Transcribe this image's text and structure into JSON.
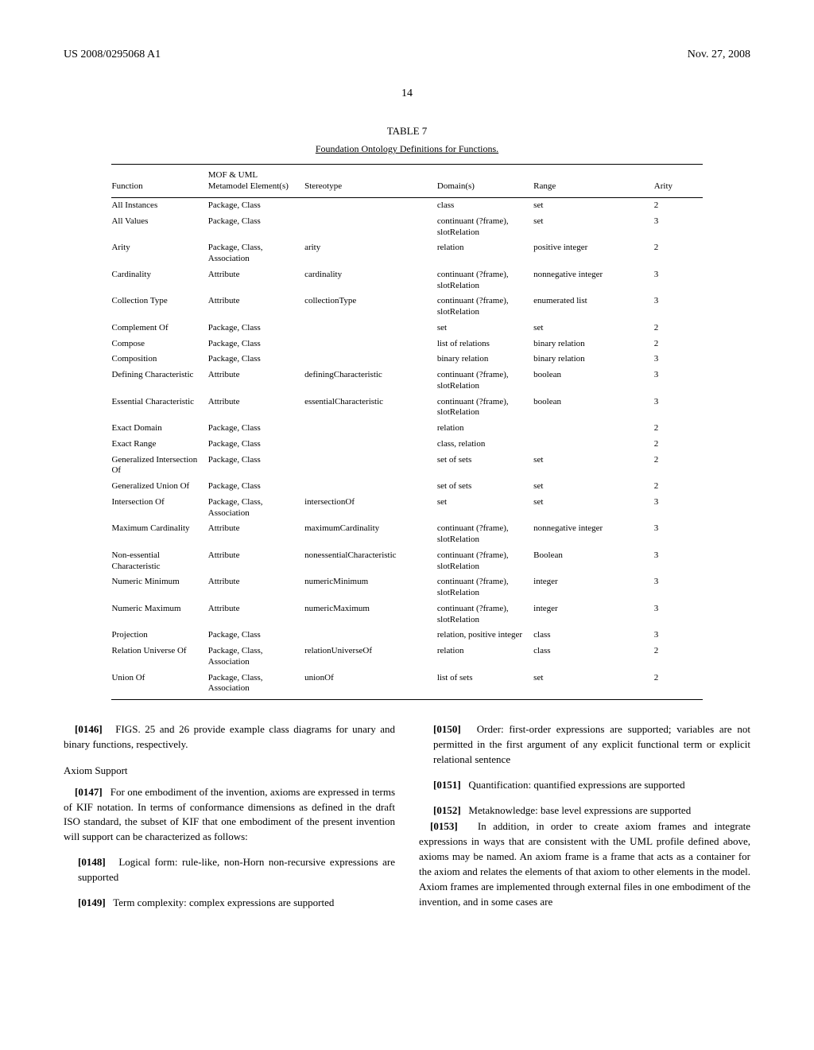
{
  "header": {
    "pub_id": "US 2008/0295068 A1",
    "pub_date": "Nov. 27, 2008",
    "page": "14"
  },
  "table": {
    "label": "TABLE 7",
    "caption": "Foundation Ontology Definitions for Functions.",
    "columns": [
      "Function",
      "MOF & UML Metamodel Element(s)",
      "Stereotype",
      "Domain(s)",
      "Range",
      "Arity"
    ],
    "rows": [
      {
        "f": "All Instances",
        "e": "Package, Class",
        "s": "",
        "d": "class",
        "r": "set",
        "a": "2"
      },
      {
        "f": "All Values",
        "e": "Package, Class",
        "s": "",
        "d": "continuant (?frame), slotRelation",
        "r": "set",
        "a": "3"
      },
      {
        "f": "Arity",
        "e": "Package, Class, Association",
        "s": "arity",
        "d": "relation",
        "r": "positive integer",
        "a": "2"
      },
      {
        "f": "Cardinality",
        "e": "Attribute",
        "s": "cardinality",
        "d": "continuant (?frame), slotRelation",
        "r": "nonnegative integer",
        "a": "3"
      },
      {
        "f": "Collection Type",
        "e": "Attribute",
        "s": "collectionType",
        "d": "continuant (?frame), slotRelation",
        "r": "enumerated list",
        "a": "3"
      },
      {
        "f": "Complement Of",
        "e": "Package, Class",
        "s": "",
        "d": "set",
        "r": "set",
        "a": "2"
      },
      {
        "f": "Compose",
        "e": "Package, Class",
        "s": "",
        "d": "list of relations",
        "r": "binary relation",
        "a": "2"
      },
      {
        "f": "Composition",
        "e": "Package, Class",
        "s": "",
        "d": "binary relation",
        "r": "binary relation",
        "a": "3"
      },
      {
        "f": "Defining Characteristic",
        "e": "Attribute",
        "s": "definingCharacteristic",
        "d": "continuant (?frame), slotRelation",
        "r": "boolean",
        "a": "3"
      },
      {
        "f": "Essential Characteristic",
        "e": "Attribute",
        "s": "essentialCharacteristic",
        "d": "continuant (?frame), slotRelation",
        "r": "boolean",
        "a": "3"
      },
      {
        "f": "Exact Domain",
        "e": "Package, Class",
        "s": "",
        "d": "relation",
        "r": "",
        "a": "2"
      },
      {
        "f": "Exact Range",
        "e": "Package, Class",
        "s": "",
        "d": "class, relation",
        "r": "",
        "a": "2"
      },
      {
        "f": "Generalized Intersection Of",
        "e": "Package, Class",
        "s": "",
        "d": "set of sets",
        "r": "set",
        "a": "2"
      },
      {
        "f": "Generalized Union Of",
        "e": "Package, Class",
        "s": "",
        "d": "set of sets",
        "r": "set",
        "a": "2"
      },
      {
        "f": "Intersection Of",
        "e": "Package, Class, Association",
        "s": "intersectionOf",
        "d": "set",
        "r": "set",
        "a": "3"
      },
      {
        "f": "Maximum Cardinality",
        "e": "Attribute",
        "s": "maximumCardinality",
        "d": "continuant (?frame), slotRelation",
        "r": "nonnegative integer",
        "a": "3"
      },
      {
        "f": "Non-essential Characteristic",
        "e": "Attribute",
        "s": "nonessentialCharacteristic",
        "d": "continuant (?frame), slotRelation",
        "r": "Boolean",
        "a": "3"
      },
      {
        "f": "Numeric Minimum",
        "e": "Attribute",
        "s": "numericMinimum",
        "d": "continuant (?frame), slotRelation",
        "r": "integer",
        "a": "3"
      },
      {
        "f": "Numeric Maximum",
        "e": "Attribute",
        "s": "numericMaximum",
        "d": "continuant (?frame), slotRelation",
        "r": "integer",
        "a": "3"
      },
      {
        "f": "Projection",
        "e": "Package, Class",
        "s": "",
        "d": "relation, positive integer",
        "r": "class",
        "a": "3"
      },
      {
        "f": "Relation Universe Of",
        "e": "Package, Class, Association",
        "s": "relationUniverseOf",
        "d": "relation",
        "r": "class",
        "a": "2"
      },
      {
        "f": "Union Of",
        "e": "Package, Class, Association",
        "s": "unionOf",
        "d": "list of sets",
        "r": "set",
        "a": "2"
      }
    ]
  },
  "body": {
    "p0146_num": "[0146]",
    "p0146": "FIGS. 25 and 26 provide example class diagrams for unary and binary functions, respectively.",
    "axiom_head": "Axiom Support",
    "p0147_num": "[0147]",
    "p0147": "For one embodiment of the invention, axioms are expressed in terms of KIF notation. In terms of conformance dimensions as defined in the draft ISO standard, the subset of KIF that one embodiment of the present invention will support can be characterized as follows:",
    "p0148_num": "[0148]",
    "p0148": "Logical form: rule-like, non-Horn non-recursive expressions are supported",
    "p0149_num": "[0149]",
    "p0149": "Term complexity: complex expressions are supported",
    "p0150_num": "[0150]",
    "p0150": "Order: first-order expressions are supported; variables are not permitted in the first argument of any explicit functional term or explicit relational sentence",
    "p0151_num": "[0151]",
    "p0151": "Quantification: quantified expressions are supported",
    "p0152_num": "[0152]",
    "p0152": "Metaknowledge: base level expressions are supported",
    "p0153_num": "[0153]",
    "p0153": "In addition, in order to create axiom frames and integrate expressions in ways that are consistent with the UML profile defined above, axioms may be named. An axiom frame is a frame that acts as a container for the axiom and relates the elements of that axiom to other elements in the model. Axiom frames are implemented through external files in one embodiment of the invention, and in some cases are"
  }
}
